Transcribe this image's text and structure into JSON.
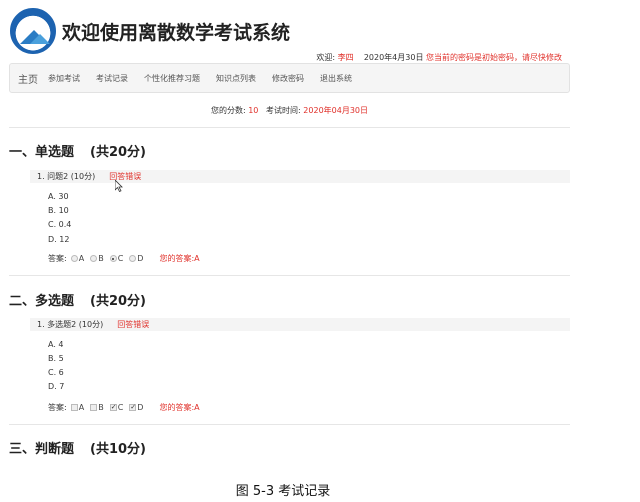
{
  "header": {
    "title": "欢迎使用离散数学考试系统"
  },
  "userbar": {
    "welcome_label": "欢迎:",
    "username": "李四",
    "date": "2020年4月30日",
    "warning": "您当前的密码是初始密码，请尽快修改"
  },
  "nav": {
    "brand": "主页",
    "items": [
      "参加考试",
      "考试记录",
      "个性化推荐习题",
      "知识点列表",
      "修改密码",
      "退出系统"
    ]
  },
  "score": {
    "score_label": "您的分数:",
    "score_value": "10",
    "time_label": "考试时间:",
    "time_value": "2020年04月30日"
  },
  "sections": [
    {
      "title": "一、单选题",
      "points": "(共20分)",
      "question": {
        "label": "1. 问题2 (10分)",
        "status": "回答错误",
        "options": [
          "A. 30",
          "B. 10",
          "C. 0.4",
          "D. 12"
        ],
        "answer_label": "答案:",
        "choices": [
          "A",
          "B",
          "C",
          "D"
        ],
        "checked": [
          "C"
        ],
        "your_answer": "您的答案:A"
      }
    },
    {
      "title": "二、多选题",
      "points": "(共20分)",
      "question": {
        "label": "1. 多选题2 (10分)",
        "status": "回答错误",
        "options": [
          "A. 4",
          "B. 5",
          "C. 6",
          "D. 7"
        ],
        "answer_label": "答案:",
        "choices": [
          "A",
          "B",
          "C",
          "D"
        ],
        "checked": [
          "C",
          "D"
        ],
        "your_answer": "您的答案:A"
      }
    },
    {
      "title": "三、判断题",
      "points": "(共10分)"
    }
  ],
  "caption": "图 5-3  考试记录",
  "colors": {
    "accent_red": "#e0302a",
    "logo_blue": "#1d63b0"
  }
}
